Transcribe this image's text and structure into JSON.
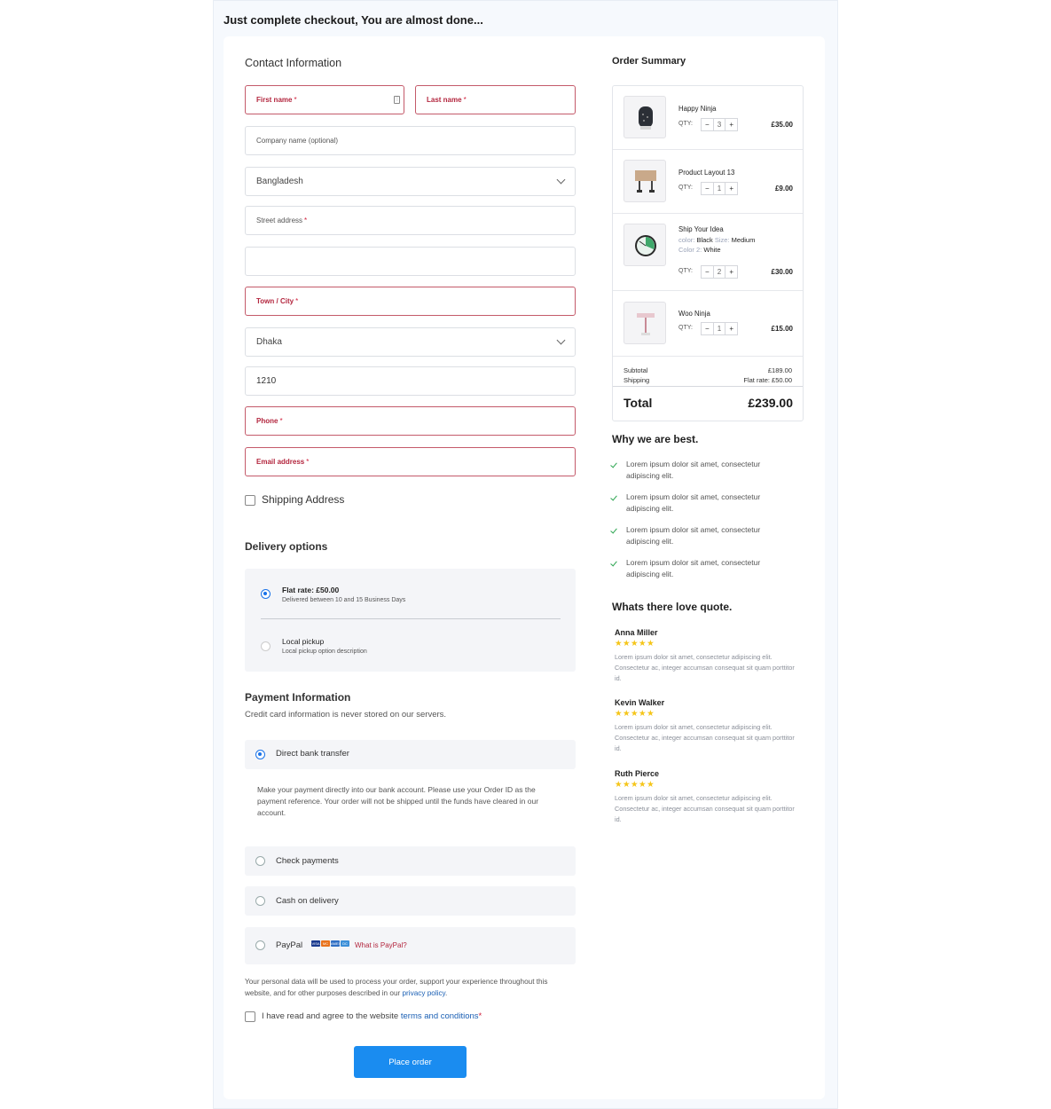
{
  "page": {
    "heading": "Just complete checkout, You are almost done..."
  },
  "contact": {
    "title": "Contact Information",
    "first_name": "First name",
    "last_name": "Last name",
    "company": "Company name (optional)",
    "country": "Bangladesh",
    "street": "Street address",
    "street2": "",
    "town": "Town / City",
    "district": "Dhaka",
    "postcode": "1210",
    "phone": "Phone",
    "email": "Email address",
    "required_mark": "*"
  },
  "shipping": {
    "label": "Shipping Address"
  },
  "delivery": {
    "title": "Delivery options",
    "options": [
      {
        "title": "Flat rate: £50.00",
        "sub": "Delivered between 10 and 15 Business Days",
        "selected": true
      },
      {
        "title": "Local pickup",
        "sub": "Local pickup option description",
        "selected": false
      }
    ]
  },
  "payment": {
    "title": "Payment Information",
    "subtitle": "Credit card information is never stored on our servers.",
    "methods": [
      {
        "label": "Direct bank transfer",
        "selected": true
      },
      {
        "label": "Check payments",
        "selected": false
      },
      {
        "label": "Cash on delivery",
        "selected": false
      },
      {
        "label": "PayPal",
        "selected": false
      }
    ],
    "bank_description": "Make your payment directly into our bank account. Please use your Order ID as the payment reference. Your order will not be shipped until the funds have cleared in our account.",
    "paypal_link": "What is PayPal?",
    "card_chips": [
      "VISA",
      "MC",
      "AMEX",
      "DC"
    ]
  },
  "privacy": {
    "text": "Your personal data will be used to process your order, support your experience throughout this website, and for other purposes described in our ",
    "link": "privacy policy",
    "end": "."
  },
  "terms": {
    "text": "I have read and agree to the website ",
    "link": "terms and conditions",
    "required_mark": "*"
  },
  "place_order": "Place order",
  "summary": {
    "title": "Order Summary",
    "qty_label": "QTY:",
    "items": [
      {
        "name": "Happy Ninja",
        "qty": "3",
        "price": "£35.00"
      },
      {
        "name": "Product Layout 13",
        "qty": "1",
        "price": "£9.00"
      },
      {
        "name": "Ship Your Idea",
        "qty": "2",
        "price": "£30.00",
        "color_key": "color:",
        "color_val": "Black",
        "size_key": "Size:",
        "size_val": "Medium",
        "color2_key": "Color 2:",
        "color2_val": "White"
      },
      {
        "name": "Woo Ninja",
        "qty": "1",
        "price": "£15.00"
      }
    ],
    "subtotal_label": "Subtotal",
    "subtotal_value": "£189.00",
    "shipping_label": "Shipping",
    "shipping_value": "Flat rate: £50.00",
    "total_label": "Total",
    "total_value": "£239.00"
  },
  "why": {
    "title": "Why we are best.",
    "items": [
      "Lorem ipsum dolor sit amet, consectetur adipiscing elit.",
      "Lorem ipsum dolor sit amet, consectetur adipiscing elit.",
      "Lorem ipsum dolor sit amet, consectetur adipiscing elit.",
      "Lorem ipsum dolor sit amet, consectetur adipiscing elit."
    ]
  },
  "reviews": {
    "title": "Whats there love quote.",
    "items": [
      {
        "name": "Anna Miller",
        "stars": "★★★★★",
        "text": "Lorem ipsum dolor sit amet, consectetur adipiscing elit. Consectetur ac, integer accumsan consequat sit quam porttitor id."
      },
      {
        "name": "Kevin Walker",
        "stars": "★★★★★",
        "text": "Lorem ipsum dolor sit amet, consectetur adipiscing elit. Consectetur ac, integer accumsan consequat sit quam porttitor id."
      },
      {
        "name": "Ruth Pierce",
        "stars": "★★★★★",
        "text": "Lorem ipsum dolor sit amet, consectetur adipiscing elit. Consectetur ac, integer accumsan consequat sit quam porttitor id."
      }
    ]
  },
  "colors": {
    "accent": "#1a8cf0",
    "error_border": "#c45a6a",
    "error_text": "#b3263e",
    "check": "#2aa44f",
    "star": "#f5c518"
  },
  "icons": [
    "chevron-down-icon",
    "key-icon",
    "check-icon",
    "star-icon"
  ]
}
